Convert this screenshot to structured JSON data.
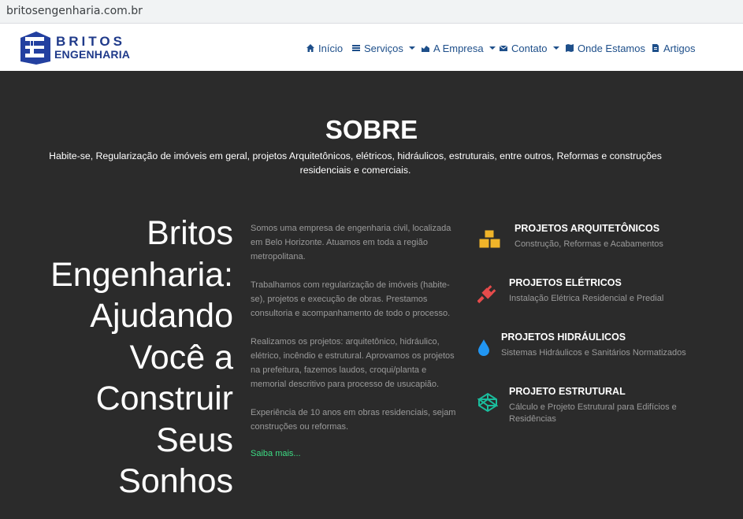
{
  "browser": {
    "url": "britosengenharia.com.br"
  },
  "logo": {
    "line1": "BRITOS",
    "line2": "ENGENHARIA"
  },
  "nav": {
    "inicio": "Início",
    "servicos": "Serviços",
    "empresa": "A Empresa",
    "contato": "Contato",
    "onde": "Onde Estamos",
    "artigos": "Artigos"
  },
  "sobre": {
    "title": "SOBRE",
    "subtitle": "Habite-se, Regularização de imóveis em geral, projetos Arquitetônicos, elétricos, hidráulicos, estruturais, entre outros, Reformas e construções residenciais e comerciais."
  },
  "hero": {
    "lines": [
      "Britos",
      "Engenharia:",
      "Ajudando",
      "Você a",
      "Construir",
      "Seus",
      "Sonhos"
    ]
  },
  "about": {
    "p1": "Somos uma empresa de engenharia civil, localizada em Belo Horizonte. Atuamos em toda a região metropolitana.",
    "p2": "Trabalhamos com regularização de imóveis (habite-se), projetos e execução de obras. Prestamos consultoria e acompanhamento de todo o processo.",
    "p3": "Realizamos os projetos: arquitetônico, hidráulico, elétrico, incêndio e estrutural. Aprovamos os projetos na prefeitura, fazemos laudos, croqui/planta e memorial descritivo para processo de usucapião.",
    "p4": "Experiência de 10 anos em obras residenciais, sejam construções ou reformas.",
    "link": "Saiba mais..."
  },
  "services": [
    {
      "title": "PROJETOS ARQUITETÔNICOS",
      "desc": "Construção, Reformas e Acabamentos",
      "icon": "cubes-icon",
      "color": "#f0b429"
    },
    {
      "title": "PROJETOS ELÉTRICOS",
      "desc": "Instalação Elétrica Residencial e Predial",
      "icon": "plug-icon",
      "color": "#e54b4b"
    },
    {
      "title": "PROJETOS HIDRÁULICOS",
      "desc": "Sistemas Hidráulicos e Sanitários Normatizados",
      "icon": "water-drop-icon",
      "color": "#2196f3"
    },
    {
      "title": "PROJETO ESTRUTURAL",
      "desc": "Cálculo e Projeto Estrutural para Edifícios e Residências",
      "icon": "codepen-icon",
      "color": "#1abc9c"
    }
  ]
}
